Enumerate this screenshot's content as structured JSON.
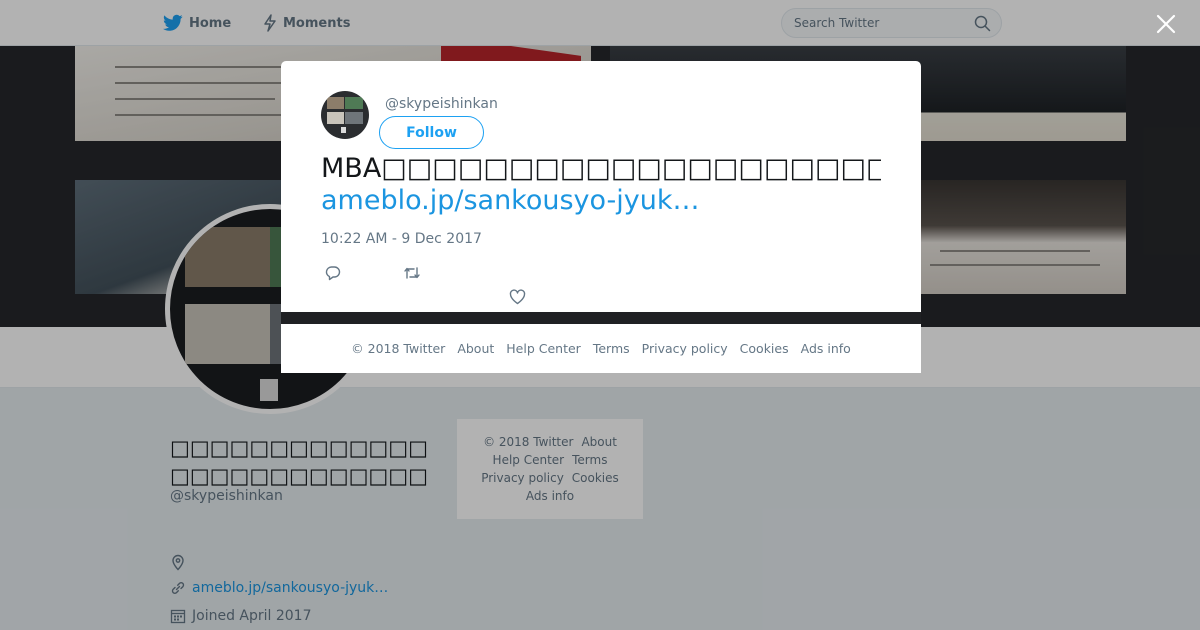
{
  "nav": {
    "home_label": "Home",
    "moments_label": "Moments",
    "search_placeholder": "Search Twitter"
  },
  "profile": {
    "name": "□□□□□□□□□□□□□□□□□□□□□□□□□□",
    "handle": "@skypeishinkan",
    "url": "ameblo.jp/sankousyo-jyuk…",
    "joined": "Joined April 2017"
  },
  "side_footer": {
    "copyright": "© 2018 Twitter",
    "about": "About",
    "help": "Help Center",
    "terms": "Terms",
    "privacy": "Privacy policy",
    "cookies": "Cookies",
    "ads": "Ads info"
  },
  "tweet": {
    "handle": "@skypeishinkan",
    "follow_label": "Follow",
    "text": "MBA□□□□□□□□□□□□□□□□□□□□□□□□□□□□□",
    "link": "ameblo.jp/sankousyo-jyuk…",
    "timestamp": "10:22 AM - 9 Dec 2017"
  },
  "modal_footer": {
    "copyright": "© 2018 Twitter",
    "about": "About",
    "help": "Help Center",
    "terms": "Terms",
    "privacy": "Privacy policy",
    "cookies": "Cookies",
    "ads": "Ads info"
  },
  "colors": {
    "accent": "#1da1f2",
    "link": "#1b95e0",
    "muted": "#657786",
    "overlay": "rgba(0,0,0,0.3)"
  },
  "icons": [
    "twitter-bird-icon",
    "lightning-icon",
    "search-icon",
    "close-icon",
    "location-icon",
    "link-icon",
    "calendar-icon",
    "reply-icon",
    "retweet-icon",
    "like-icon"
  ]
}
